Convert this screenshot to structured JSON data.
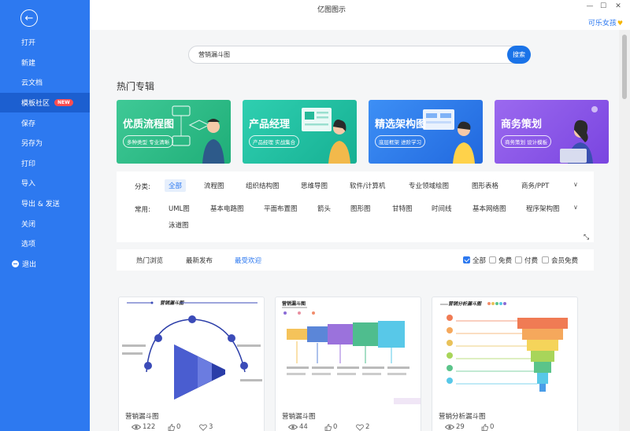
{
  "window": {
    "title": "亿图图示",
    "user": "可乐女孩"
  },
  "sidebar": {
    "back": "←",
    "items": [
      {
        "label": "打开"
      },
      {
        "label": "新建"
      },
      {
        "label": "云文档"
      },
      {
        "label": "模板社区",
        "badge": "NEW"
      },
      {
        "label": "保存"
      },
      {
        "label": "另存为"
      },
      {
        "label": "打印"
      },
      {
        "label": "导入"
      },
      {
        "label": "导出 & 发送"
      },
      {
        "label": "关闭"
      },
      {
        "label": "选项"
      },
      {
        "label": "退出"
      }
    ]
  },
  "search": {
    "value": "营销漏斗图",
    "button": "搜索"
  },
  "hot": {
    "title": "热门专辑",
    "banners": [
      {
        "title": "优质流程图",
        "sub": "多种类型 专业清晰",
        "color_from": "#3fc996",
        "color_to": "#1fae78"
      },
      {
        "title": "产品经理",
        "sub": "产品经理 实战集合",
        "color_from": "#2fcfb0",
        "color_to": "#16b093"
      },
      {
        "title": "精选架构图",
        "sub": "底层框架 进阶学习",
        "color_from": "#3d8ff5",
        "color_to": "#2168de"
      },
      {
        "title": "商务策划",
        "sub": "商务策划 设计模板",
        "color_from": "#9b69ef",
        "color_to": "#7a45e0"
      }
    ]
  },
  "filters": {
    "category_label": "分类:",
    "categories": [
      "全部",
      "流程图",
      "组织结构图",
      "思维导图",
      "软件/计算机",
      "专业领域绘图",
      "图形表格",
      "商务/PPT"
    ],
    "common_label": "常用:",
    "common": [
      "UML图",
      "基本电路图",
      "平面布置图",
      "箭头",
      "图形图",
      "甘特图",
      "时间线",
      "基本网络图",
      "程序架构图",
      "泳道图"
    ]
  },
  "tabs": [
    "热门浏览",
    "最新发布",
    "最受欢迎"
  ],
  "price_filters": [
    {
      "label": "全部",
      "checked": true
    },
    {
      "label": "免费",
      "checked": false
    },
    {
      "label": "付费",
      "checked": false
    },
    {
      "label": "会员免费",
      "checked": false
    }
  ],
  "cards": [
    {
      "title": "营销漏斗图",
      "views": "122",
      "likes": "0",
      "favs": "3",
      "preview_title": "营销漏斗图"
    },
    {
      "title": "营销漏斗图",
      "views": "44",
      "likes": "0",
      "favs": "2",
      "preview_title": "营销漏斗图"
    },
    {
      "title": "营销分析漏斗图",
      "views": "29",
      "likes": "0",
      "favs": "",
      "preview_title": "营销分析漏斗图"
    }
  ]
}
